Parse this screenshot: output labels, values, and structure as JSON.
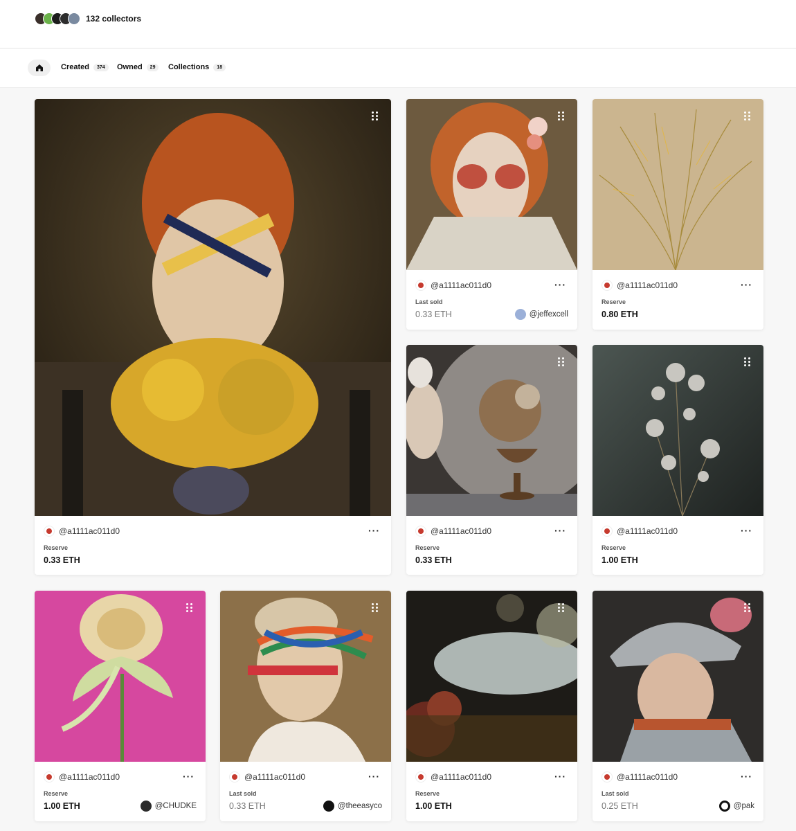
{
  "header": {
    "collectors_text": "132 collectors",
    "collector_avatar_colors": [
      "#3a2f2a",
      "#6bb24a",
      "#1c1c1c",
      "#2d2d2d",
      "#7a8aa0"
    ]
  },
  "tabs": {
    "home_icon": "home-icon",
    "created": {
      "label": "Created",
      "count": "374"
    },
    "owned": {
      "label": "Owned",
      "count": "29"
    },
    "collections": {
      "label": "Collections",
      "count": "18"
    }
  },
  "cards": [
    {
      "creator": "@a1111ac011d0",
      "label": "Reserve",
      "price": "0.33 ETH",
      "owner": "",
      "art": "portrait of a red-haired child with ribbon eye mask and yellow flowers"
    },
    {
      "creator": "@a1111ac011d0",
      "label": "Last sold",
      "price": "0.33 ETH",
      "owner": "@jeffexcell",
      "art": "red-haired figure with painted face and flowers"
    },
    {
      "creator": "@a1111ac011d0",
      "label": "Reserve",
      "price": "0.80 ETH",
      "owner": "",
      "art": "dry grass stems"
    },
    {
      "creator": "@a1111ac011d0",
      "label": "Reserve",
      "price": "0.33 ETH",
      "owner": "",
      "art": "still life with dried flowers in a vase"
    },
    {
      "creator": "@a1111ac011d0",
      "label": "Reserve",
      "price": "1.00 ETH",
      "owner": "",
      "art": "silver flower sprigs on dark background"
    },
    {
      "creator": "@a1111ac011d0",
      "label": "Reserve",
      "price": "1.00 ETH",
      "owner": "@CHUDKE",
      "art": "pale rose with ribbon on pink background"
    },
    {
      "creator": "@a1111ac011d0",
      "label": "Last sold",
      "price": "0.33 ETH",
      "owner": "@theeasyco",
      "art": "portrait with colorful ribbons over eyes"
    },
    {
      "creator": "@a1111ac011d0",
      "label": "Reserve",
      "price": "1.00 ETH",
      "owner": "",
      "art": "dark flowers with bokeh lights"
    },
    {
      "creator": "@a1111ac011d0",
      "label": "Last sold",
      "price": "0.25 ETH",
      "owner": "@pak",
      "art": "girl in silver armor helmet with flowers"
    }
  ],
  "colors": {
    "owner_avatars": [
      "#9bb0d8",
      "#2b2b2b",
      "#111111",
      "#ffffff"
    ]
  }
}
